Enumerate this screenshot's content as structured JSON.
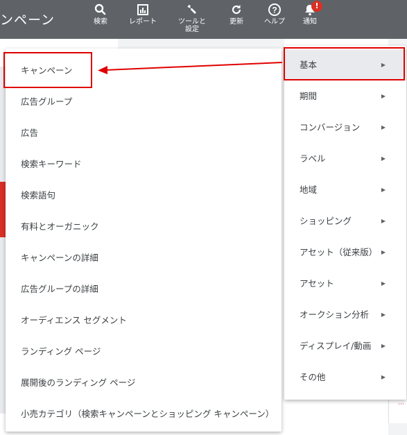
{
  "header": {
    "page_title": "ンペーン",
    "tools": [
      {
        "icon": "search-icon",
        "label": "検索"
      },
      {
        "icon": "report-icon",
        "label": "レポート"
      },
      {
        "icon": "wrench-icon",
        "label": "ツールと\n設定"
      },
      {
        "icon": "refresh-icon",
        "label": "更新"
      },
      {
        "icon": "help-icon",
        "label": "ヘルプ"
      },
      {
        "icon": "bell-icon",
        "label": "通知"
      }
    ],
    "notification_badge": "!"
  },
  "left_menu": {
    "items": [
      "キャンペーン",
      "広告グループ",
      "広告",
      "検索キーワード",
      "検索語句",
      "有料とオーガニック",
      "キャンペーンの詳細",
      "広告グループの詳細",
      "オーディエンス セグメント",
      "ランディング ページ",
      "展開後のランディング ページ",
      "小売カテゴリ（検索キャンペーンとショッピング キャンペーン）"
    ]
  },
  "right_menu": {
    "items": [
      "基本",
      "期間",
      "コンバージョン",
      "ラベル",
      "地域",
      "ショッピング",
      "アセット（従来版）",
      "アセット",
      "オークション分析",
      "ディスプレイ/動画",
      "その他"
    ],
    "chevron": "▶"
  },
  "colors": {
    "topbar": "#5f6368",
    "highlight": "#e00000",
    "badge": "#d93025"
  }
}
